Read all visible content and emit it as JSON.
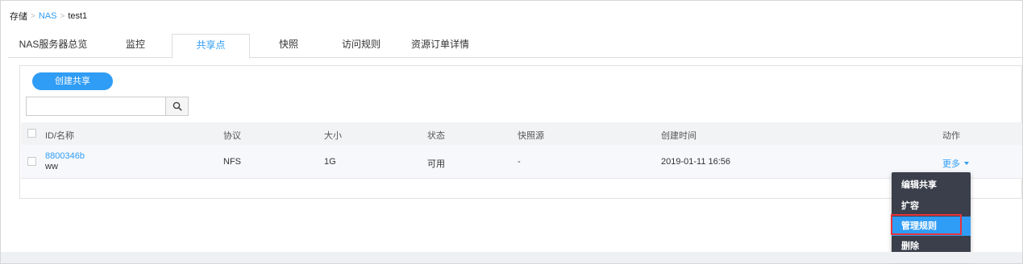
{
  "breadcrumb": {
    "root": "存储",
    "separator": ">",
    "link": "NAS",
    "current": "test1"
  },
  "tabs": [
    {
      "label": "NAS服务器总览",
      "active": false
    },
    {
      "label": "监控",
      "active": false
    },
    {
      "label": "共享点",
      "active": true
    },
    {
      "label": "快照",
      "active": false
    },
    {
      "label": "访问规则",
      "active": false
    },
    {
      "label": "资源订单详情",
      "active": false
    }
  ],
  "toolbar": {
    "create_label": "创建共享",
    "search_placeholder": "",
    "search_value": "",
    "search_icon": "search-icon"
  },
  "table": {
    "headers": {
      "id_name": "ID/名称",
      "protocol": "协议",
      "size": "大小",
      "status": "状态",
      "snapshot_source": "快照源",
      "created": "创建时间",
      "actions": "动作"
    },
    "rows": [
      {
        "id": "8800346b",
        "name": "ww",
        "protocol": "NFS",
        "size": "1G",
        "status": "可用",
        "snapshot_source": "-",
        "created": "2019-01-11 16:56",
        "more": "更多"
      }
    ]
  },
  "dropdown": {
    "items": [
      {
        "label": "编辑共享",
        "active": false
      },
      {
        "label": "扩容",
        "active": false
      },
      {
        "label": "管理规则",
        "active": true
      },
      {
        "label": "删除",
        "active": false
      }
    ]
  },
  "colors": {
    "accent": "#2f9cf5",
    "menu_bg": "#3a3f4b",
    "highlight": "#e8333a"
  }
}
